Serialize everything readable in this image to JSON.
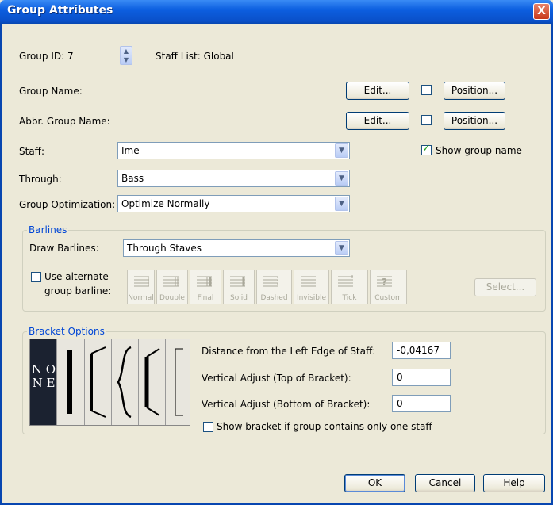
{
  "window": {
    "title": "Group Attributes",
    "close_label": "X"
  },
  "group_id": {
    "label": "Group ID: 7",
    "staff_list": "Staff List:  Global"
  },
  "group_name": {
    "label": "Group Name:",
    "edit": "Edit...",
    "position": "Position..."
  },
  "abbr_group_name": {
    "label": "Abbr. Group Name:",
    "edit": "Edit...",
    "position": "Position..."
  },
  "staff": {
    "label": "Staff:",
    "value": "Ime"
  },
  "through": {
    "label": "Through:",
    "value": "Bass"
  },
  "optimization": {
    "label": "Group Optimization:",
    "value": "Optimize Normally"
  },
  "show_group_name": {
    "label": "Show group name",
    "checked": true
  },
  "barlines": {
    "title": "Barlines",
    "draw_label": "Draw Barlines:",
    "draw_value": "Through Staves",
    "alternate_label_1": "Use alternate",
    "alternate_label_2": "group barline:",
    "types": [
      "Normal",
      "Double",
      "Final",
      "Solid",
      "Dashed",
      "Invisible",
      "Tick",
      "Custom"
    ],
    "select": "Select..."
  },
  "bracket": {
    "title": "Bracket Options",
    "none_label": "N O N E",
    "distance_label": "Distance from the Left Edge of Staff:",
    "distance_value": "-0,04167",
    "top_label": "Vertical Adjust (Top of Bracket):",
    "top_value": "0",
    "bottom_label": "Vertical Adjust (Bottom of Bracket):",
    "bottom_value": "0",
    "one_staff_label": "Show bracket if group contains only one staff"
  },
  "footer": {
    "ok": "OK",
    "cancel": "Cancel",
    "help": "Help"
  },
  "colors": {
    "title_bar": "#0a4fc8",
    "group_title": "#0046d5",
    "bg": "#ece9d8"
  }
}
